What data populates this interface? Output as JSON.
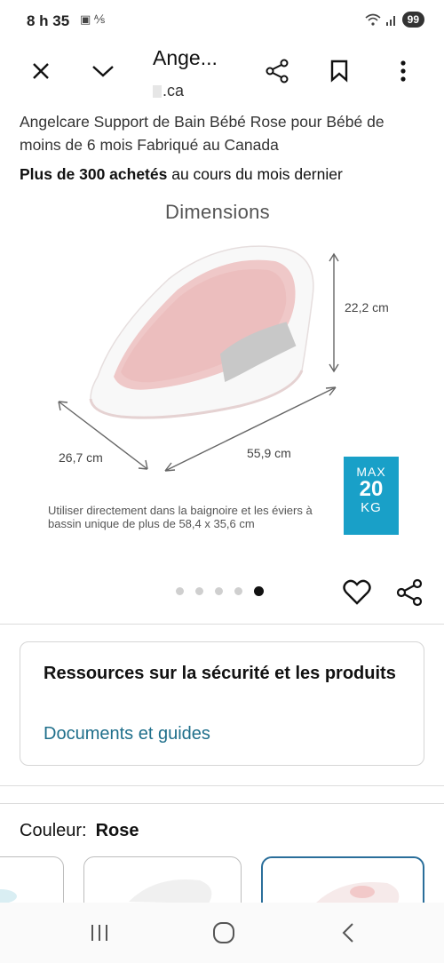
{
  "status": {
    "time": "8 h 35",
    "left_icons": "▣ ⅍",
    "battery": "99"
  },
  "toolbar": {
    "title": "Ange...",
    "url": ".ca"
  },
  "product": {
    "title": "Angelcare Support de Bain Bébé Rose pour Bébé de moins de 6 mois Fabriqué au Canada",
    "purchase_bold": "Plus de 300 achetés",
    "purchase_rest": " au cours du mois dernier"
  },
  "image": {
    "heading": "Dimensions",
    "height": "22,2 cm",
    "length": "55,9 cm",
    "width": "26,7 cm",
    "note": "Utiliser directement dans la baignoire et les éviers à bassin unique de plus de 58,4 x 35,6 cm",
    "badge_max": "MAX",
    "badge_value": "20",
    "badge_unit": "KG",
    "accent_color": "#19a0c8",
    "image_count": 5,
    "active_image": 5
  },
  "resources": {
    "title": "Ressources sur la sécurité et les produits",
    "link": "Documents et guides"
  },
  "color": {
    "label": "Couleur:",
    "value": "Rose"
  }
}
